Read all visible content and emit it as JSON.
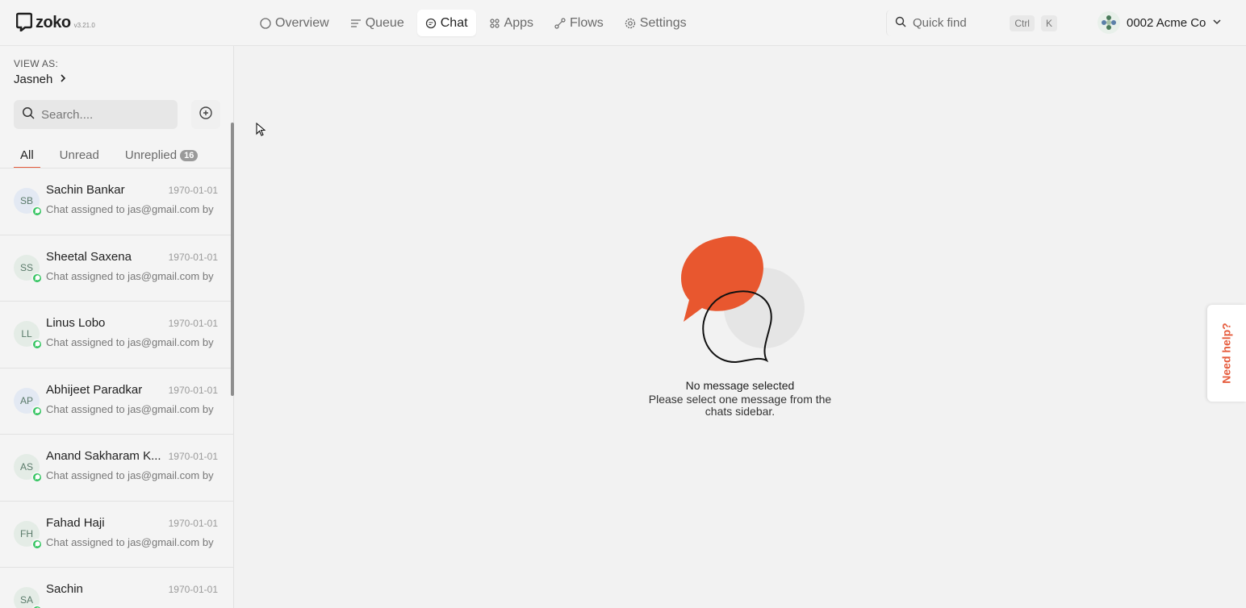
{
  "app": {
    "logo_text": "zoko",
    "version": "v3.21.0"
  },
  "nav": {
    "items": [
      {
        "label": "Overview",
        "icon": "circle-icon",
        "active": false
      },
      {
        "label": "Queue",
        "icon": "list-icon",
        "active": false
      },
      {
        "label": "Chat",
        "icon": "chat-bubble-icon",
        "active": true
      },
      {
        "label": "Apps",
        "icon": "grid-icon",
        "active": false
      },
      {
        "label": "Flows",
        "icon": "flow-icon",
        "active": false
      },
      {
        "label": "Settings",
        "icon": "gear-icon",
        "active": false
      }
    ]
  },
  "quickfind": {
    "placeholder": "Quick find",
    "key1": "Ctrl",
    "key2": "K"
  },
  "org": {
    "name": "0002 Acme Co"
  },
  "sidebar": {
    "view_as_label": "VIEW AS:",
    "view_as_user": "Jasneh",
    "search_placeholder": "Search....",
    "tabs": [
      {
        "label": "All",
        "active": true
      },
      {
        "label": "Unread",
        "active": false
      },
      {
        "label": "Unreplied",
        "active": false,
        "badge": "16"
      }
    ],
    "chats": [
      {
        "initials": "SB",
        "name": "Sachin Bankar",
        "date": "1970-01-01",
        "preview": "Chat assigned to jas@gmail.com by",
        "avatar_bg": "#e3e9f3"
      },
      {
        "initials": "SS",
        "name": "Sheetal Saxena",
        "date": "1970-01-01",
        "preview": "Chat assigned to jas@gmail.com by",
        "avatar_bg": "#e4ece6"
      },
      {
        "initials": "LL",
        "name": "Linus Lobo",
        "date": "1970-01-01",
        "preview": "Chat assigned to jas@gmail.com by",
        "avatar_bg": "#e4ece6"
      },
      {
        "initials": "AP",
        "name": "Abhijeet Paradkar",
        "date": "1970-01-01",
        "preview": "Chat assigned to jas@gmail.com by",
        "avatar_bg": "#e3e9f3"
      },
      {
        "initials": "AS",
        "name": "Anand Sakharam K...",
        "date": "1970-01-01",
        "preview": "Chat assigned to jas@gmail.com by",
        "avatar_bg": "#e4ece6"
      },
      {
        "initials": "FH",
        "name": "Fahad Haji",
        "date": "1970-01-01",
        "preview": "Chat assigned to jas@gmail.com by",
        "avatar_bg": "#e4ece6"
      },
      {
        "initials": "SA",
        "name": "Sachin",
        "date": "1970-01-01",
        "preview": "",
        "avatar_bg": "#e4ece6"
      }
    ]
  },
  "main": {
    "empty_title": "No message selected",
    "empty_subtitle": "Please select one message from the chats sidebar."
  },
  "help": {
    "label": "Need help?"
  },
  "colors": {
    "accent": "#e65c3d",
    "whatsapp": "#32c45f"
  }
}
